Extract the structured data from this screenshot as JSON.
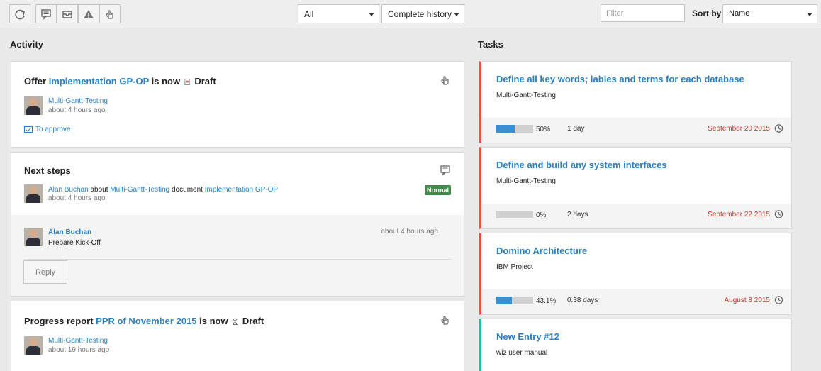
{
  "toolbar": {
    "filter_type": "All",
    "history": "Complete history",
    "filter_placeholder": "Filter",
    "sort_label": "Sort by",
    "sort_value": "Name"
  },
  "activity": {
    "title": "Activity",
    "cards": [
      {
        "prefix": "Offer",
        "link": "Implementation GP-OP",
        "mid": "is now",
        "status": "Draft",
        "project": "Multi-Gantt-Testing",
        "time": "about 4 hours ago",
        "action": "To approve"
      },
      {
        "title": "Next steps",
        "author": "Alan Buchan",
        "about": "about",
        "project": "Multi-Gantt-Testing",
        "doc_word": "document",
        "doc_link": "Implementation GP-OP",
        "time": "about 4 hours ago",
        "priority": "Normal",
        "comment_author": "Alan Buchan",
        "comment_time": "about 4 hours ago",
        "comment_text": "Prepare Kick-Off",
        "reply": "Reply"
      },
      {
        "prefix": "Progress report",
        "link": "PPR of November 2015",
        "mid": "is now",
        "status": "Draft",
        "project": "Multi-Gantt-Testing",
        "time": "about 19 hours ago"
      }
    ]
  },
  "tasks": {
    "title": "Tasks",
    "items": [
      {
        "name": "Define all key words; lables and terms for each database",
        "project": "Multi-Gantt-Testing",
        "progress": 0.5,
        "progress_label": "50%",
        "duration": "1 day",
        "due": "September 20 2015",
        "color": "#e0524b"
      },
      {
        "name": "Define and build any system interfaces",
        "project": "Multi-Gantt-Testing",
        "progress": 0.0,
        "progress_label": "0%",
        "duration": "2 days",
        "due": "September 22 2015",
        "color": "#e0524b"
      },
      {
        "name": "Domino Architecture",
        "project": "IBM Project",
        "progress": 0.431,
        "progress_label": "43.1%",
        "duration": "0.38 days",
        "due": "August 8 2015",
        "color": "#e0524b"
      },
      {
        "name": "New Entry #12",
        "project": "wiz user manual",
        "color": "#2bb59a"
      }
    ]
  }
}
